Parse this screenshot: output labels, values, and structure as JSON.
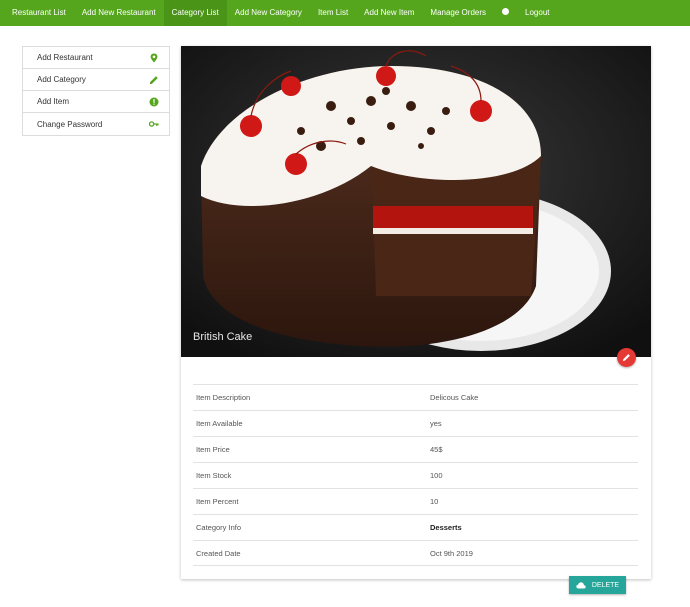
{
  "nav": {
    "items": [
      {
        "label": "Restaurant List"
      },
      {
        "label": "Add New Restaurant"
      },
      {
        "label": "Category List"
      },
      {
        "label": "Add New Category"
      },
      {
        "label": "Item List"
      },
      {
        "label": "Add New Item"
      },
      {
        "label": "Manage Orders"
      }
    ],
    "globe_icon": "globe-icon",
    "logout_label": "Logout",
    "bar_color": "#55a61d"
  },
  "sidebar": {
    "items": [
      {
        "label": "Add Restaurant",
        "icon": "location-pin-icon"
      },
      {
        "label": "Add Category",
        "icon": "pencil-icon"
      },
      {
        "label": "Add Item",
        "icon": "info-icon"
      },
      {
        "label": "Change Password",
        "icon": "key-icon"
      }
    ],
    "icon_color": "#55a61d"
  },
  "item": {
    "image_caption": "British Cake",
    "details": [
      {
        "label": "Item Description",
        "value": "Delicous Cake"
      },
      {
        "label": "Item Available",
        "value": "yes"
      },
      {
        "label": "Item Price",
        "value": "45$"
      },
      {
        "label": "Item Stock",
        "value": "100"
      },
      {
        "label": "Item Percent",
        "value": "10"
      },
      {
        "label": "Category Info",
        "value": "Desserts"
      },
      {
        "label": "Created Date",
        "value": "Oct 9th 2019"
      }
    ],
    "edit_color": "#e53935"
  },
  "actions": {
    "delete_label": "DELETE",
    "delete_icon": "cloud-icon",
    "delete_color": "#26a69a"
  }
}
